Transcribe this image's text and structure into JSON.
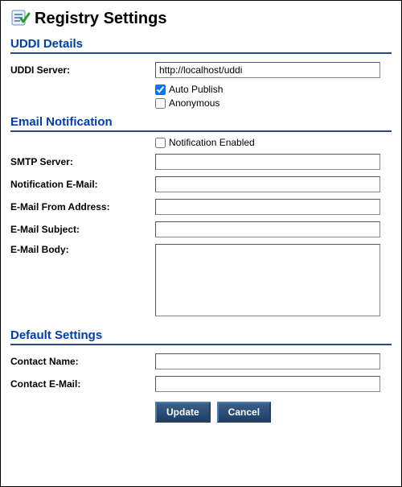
{
  "page": {
    "title": "Registry Settings"
  },
  "uddi": {
    "section_title": "UDDI Details",
    "server_label": "UDDI Server:",
    "server_value": "http://localhost/uddi",
    "auto_publish_label": "Auto Publish",
    "auto_publish_checked": true,
    "anonymous_label": "Anonymous",
    "anonymous_checked": false
  },
  "email": {
    "section_title": "Email Notification",
    "notification_enabled_label": "Notification Enabled",
    "notification_enabled_checked": false,
    "smtp_label": "SMTP Server:",
    "smtp_value": "",
    "notify_email_label": "Notification E-Mail:",
    "notify_email_value": "",
    "from_label": "E-Mail From Address:",
    "from_value": "",
    "subject_label": "E-Mail Subject:",
    "subject_value": "",
    "body_label": "E-Mail Body:",
    "body_value": ""
  },
  "defaults": {
    "section_title": "Default Settings",
    "contact_name_label": "Contact Name:",
    "contact_name_value": "",
    "contact_email_label": "Contact E-Mail:",
    "contact_email_value": ""
  },
  "buttons": {
    "update": "Update",
    "cancel": "Cancel"
  }
}
